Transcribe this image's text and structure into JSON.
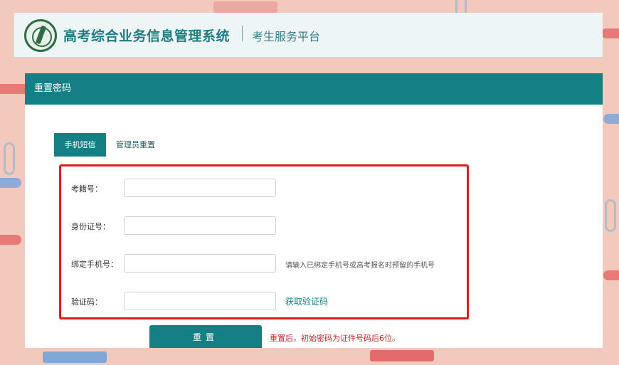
{
  "header": {
    "title": "高考综合业务信息管理系统",
    "subtitle": "考生服务平台"
  },
  "panel": {
    "title": "重置密码"
  },
  "tabs": [
    {
      "label": "手机短信",
      "active": true
    },
    {
      "label": "管理员重置",
      "active": false
    }
  ],
  "form": {
    "exam_no": {
      "label": "考籍号：",
      "value": ""
    },
    "id_no": {
      "label": "身份证号：",
      "value": ""
    },
    "phone": {
      "label": "绑定手机号：",
      "value": "",
      "hint": "请输入已绑定手机号或高考报名时预留的手机号"
    },
    "code": {
      "label": "验证码：",
      "value": "",
      "link": "获取验证码"
    }
  },
  "actions": {
    "reset_label": "重置",
    "reset_note": "重置后，初始密码为证件号码后6位。"
  },
  "colors": {
    "accent": "#147f84",
    "highlight_border": "#e01b1b",
    "warning_text": "#d22222",
    "background": "#f3c9bd"
  }
}
